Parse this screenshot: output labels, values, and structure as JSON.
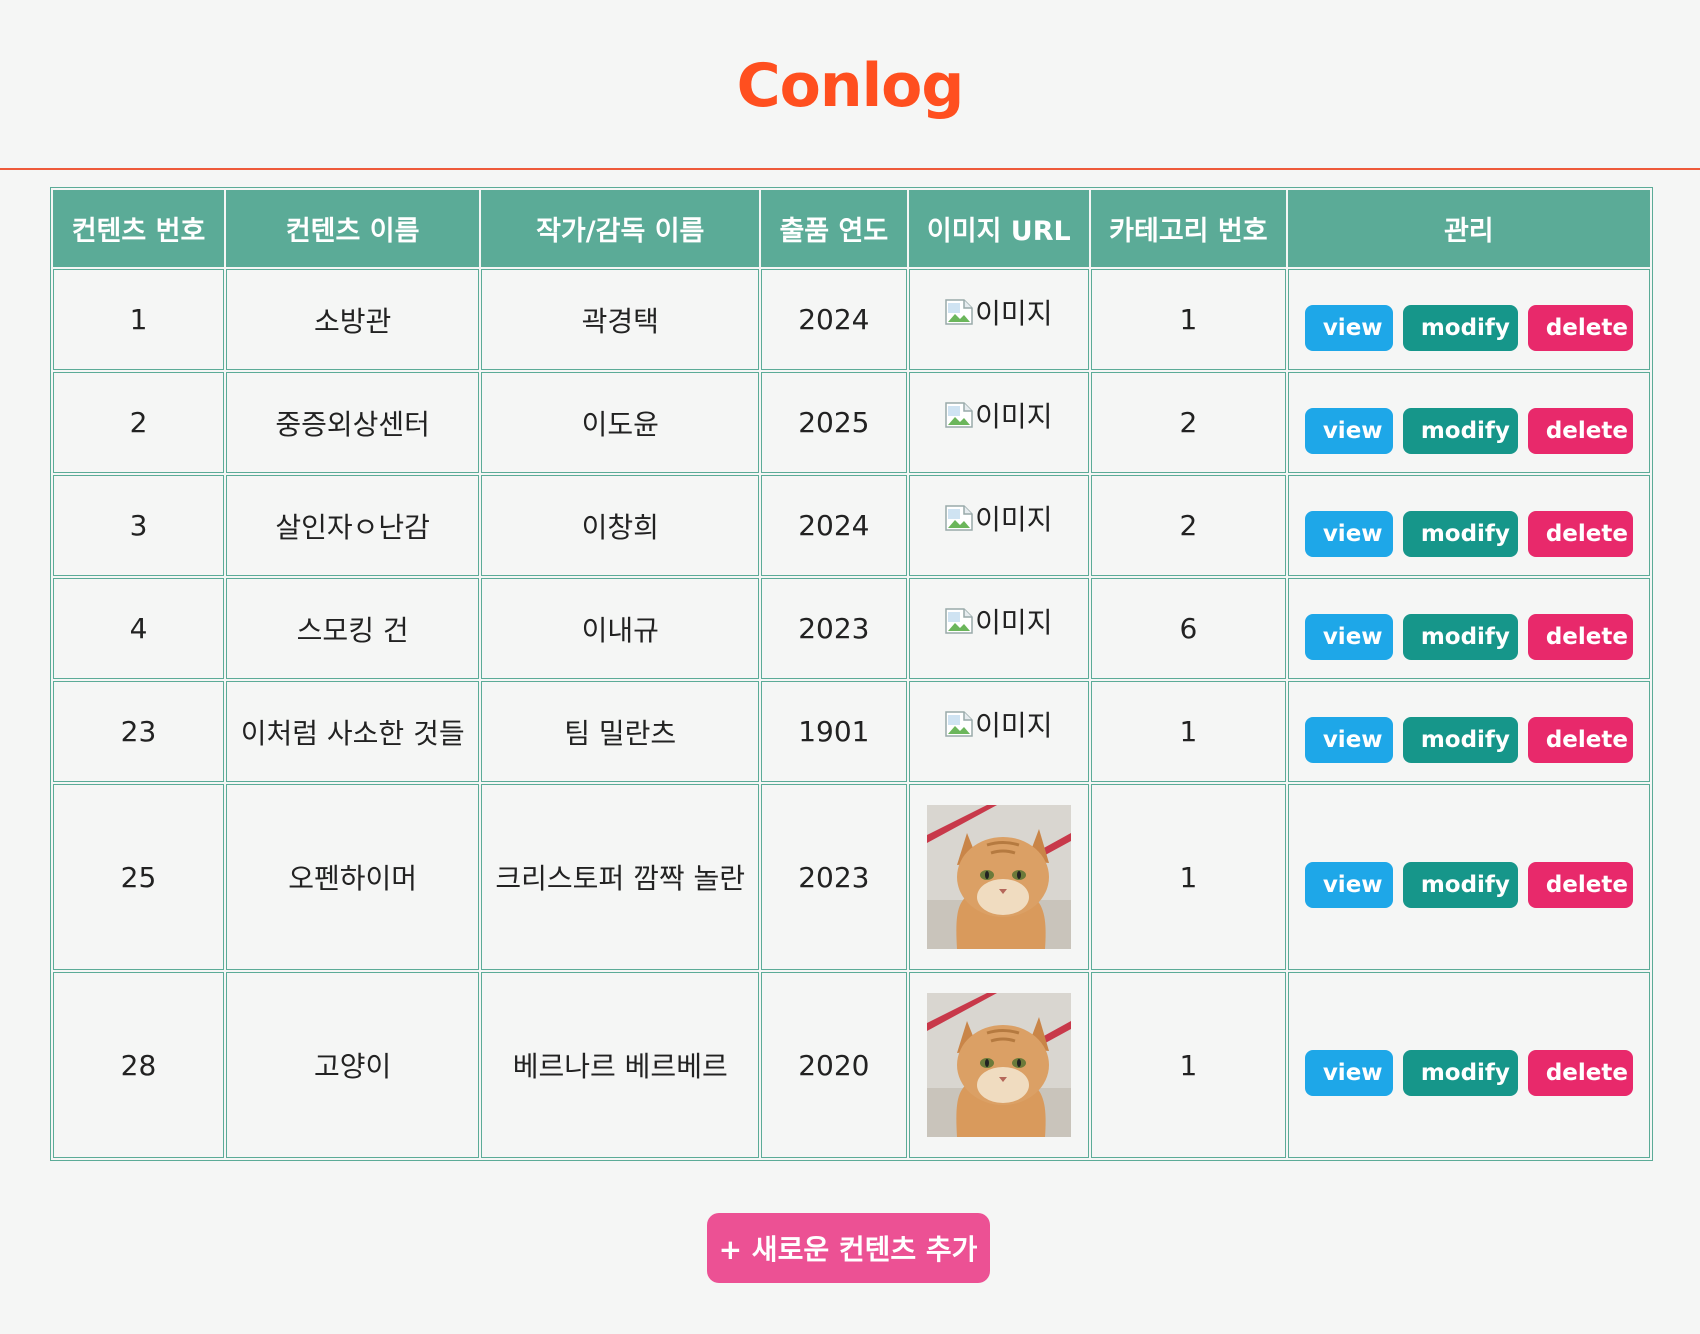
{
  "app": {
    "title": "Conlog"
  },
  "table": {
    "headers": [
      "컨텐츠 번호",
      "컨텐츠 이름",
      "작가/감독 이름",
      "출품 연도",
      "이미지 URL",
      "카테고리 번호",
      "관리"
    ],
    "rows": [
      {
        "id": "1",
        "name": "소방관",
        "author": "곽경택",
        "year": "2024",
        "image": "broken",
        "image_alt": "이미지",
        "category": "1"
      },
      {
        "id": "2",
        "name": "중증외상센터",
        "author": "이도윤",
        "year": "2025",
        "image": "broken",
        "image_alt": "이미지",
        "category": "2"
      },
      {
        "id": "3",
        "name": "살인자ㅇ난감",
        "author": "이창희",
        "year": "2024",
        "image": "broken",
        "image_alt": "이미지",
        "category": "2"
      },
      {
        "id": "4",
        "name": "스모킹 건",
        "author": "이내규",
        "year": "2023",
        "image": "broken",
        "image_alt": "이미지",
        "category": "6"
      },
      {
        "id": "23",
        "name": "이처럼 사소한 것들",
        "author": "팀 밀란츠",
        "year": "1901",
        "image": "broken",
        "image_alt": "이미지",
        "category": "1"
      },
      {
        "id": "25",
        "name": "오펜하이머",
        "author": "크리스토퍼 깜짝 놀란",
        "year": "2023",
        "image": "cat-photo",
        "image_alt": "",
        "category": "1"
      },
      {
        "id": "28",
        "name": "고양이",
        "author": "베르나르 베르베르",
        "year": "2020",
        "image": "cat-photo",
        "image_alt": "",
        "category": "1"
      }
    ],
    "actions": {
      "view": "view",
      "modify": "modify",
      "delete": "delete"
    }
  },
  "add_button": {
    "label": "+ 새로운 컨텐츠 추가"
  },
  "colors": {
    "title": "#ff4f1f",
    "header_bg": "#5bab97",
    "view": "#1ea7e8",
    "modify": "#16968a",
    "delete": "#e8296b",
    "add": "#ec5194"
  },
  "icons": {
    "broken_image": "broken-image-icon",
    "thumbnail": "cat-photo-thumbnail"
  }
}
